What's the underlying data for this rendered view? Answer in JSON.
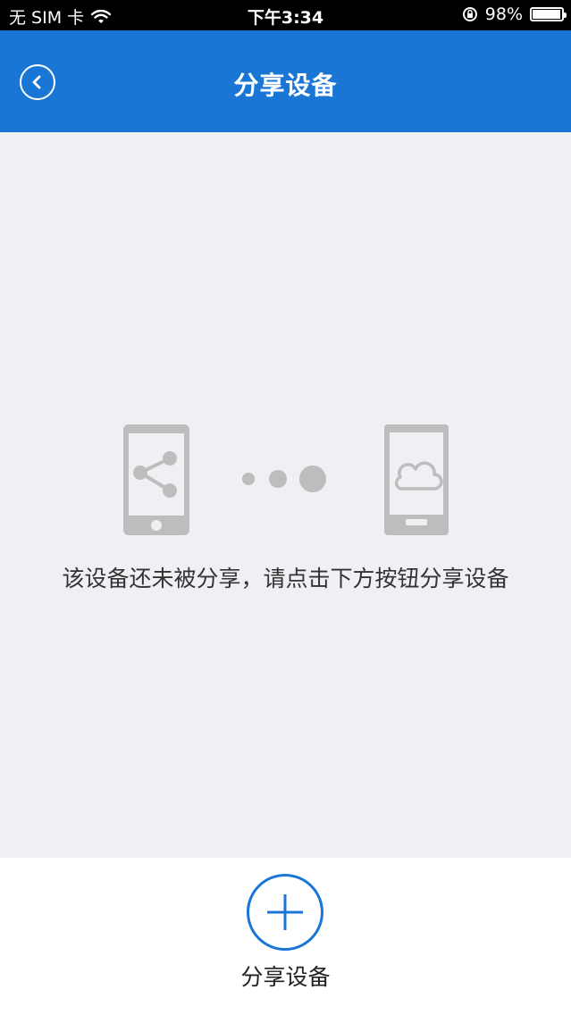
{
  "status_bar": {
    "carrier": "无 SIM 卡",
    "time": "下午3:34",
    "battery_percent": "98%",
    "battery_level": 0.98
  },
  "nav": {
    "title": "分享设备",
    "back_icon": "chevron-left-icon"
  },
  "empty_state": {
    "message": "该设备还未被分享，请点击下方按钮分享设备",
    "icons": [
      "phone-share-icon",
      "progress-dots-icon",
      "phone-cloud-icon"
    ]
  },
  "bottom": {
    "share_label": "分享设备",
    "share_icon": "plus-icon"
  },
  "colors": {
    "primary": "#1976d4",
    "status_bar": "#000000",
    "content_bg": "#f0eff4",
    "illustration": "#bdbdbd"
  }
}
